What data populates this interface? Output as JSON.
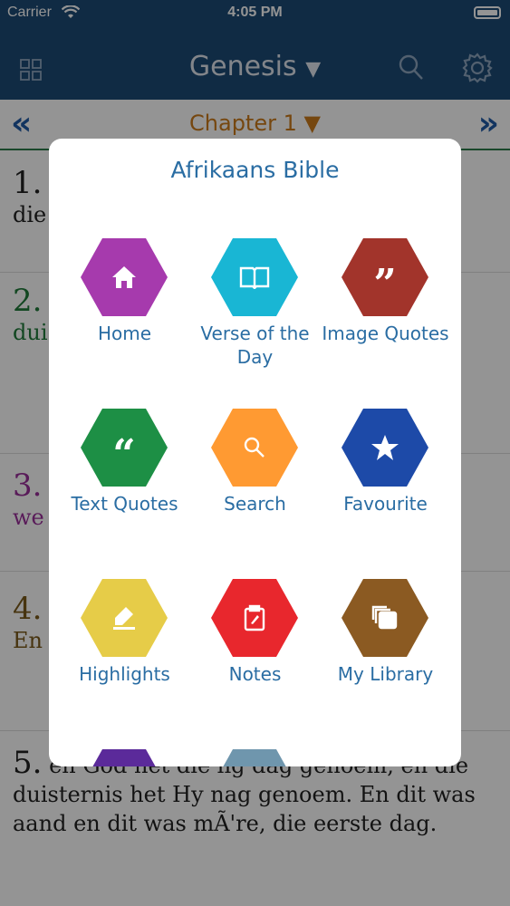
{
  "status_bar": {
    "carrier": "Carrier",
    "time": "4:05 PM"
  },
  "nav": {
    "title": "Genesis",
    "caret": "▼"
  },
  "chapter_bar": {
    "title": "Chapter 1",
    "caret": "▼",
    "prev": "«",
    "next": "»"
  },
  "verses": [
    {
      "num": "1.",
      "text": "die",
      "color": "#222222"
    },
    {
      "num": "2.",
      "text": "dui en die wa",
      "color": "#1f7a3a"
    },
    {
      "num": "3.",
      "text": "we",
      "color": "#9a2f9a"
    },
    {
      "num": "4.",
      "text": "En ie lig",
      "color": "#7a5a1a"
    },
    {
      "num": "5.",
      "text": "en God het die lig dag genoem, en die duisternis het Hy nag genoem. En dit was aand en dit was mÃ're, die eerste dag.",
      "color": "#222222"
    }
  ],
  "menu": {
    "title": "Afrikaans Bible",
    "items": [
      {
        "label": "Home",
        "icon": "home-icon",
        "color": "#a63aad"
      },
      {
        "label": "Verse of the Day",
        "icon": "book-icon",
        "color": "#19b6d4"
      },
      {
        "label": "Image Quotes",
        "icon": "quote-icon",
        "color": "#a2342b"
      },
      {
        "label": "Text Quotes",
        "icon": "quote-open-icon",
        "color": "#1d8f45"
      },
      {
        "label": "Search",
        "icon": "search-icon",
        "color": "#ff9a32"
      },
      {
        "label": "Favourite",
        "icon": "star-icon",
        "color": "#1d4aa8"
      },
      {
        "label": "Highlights",
        "icon": "highlighter-icon",
        "color": "#e6cc48"
      },
      {
        "label": "Notes",
        "icon": "clipboard-icon",
        "color": "#e8272d"
      },
      {
        "label": "My Library",
        "icon": "library-icon",
        "color": "#8b5a22"
      },
      {
        "label": "",
        "icon": "",
        "color": "#5b2a9a"
      },
      {
        "label": "",
        "icon": "",
        "color": "#6f96ad"
      }
    ]
  }
}
